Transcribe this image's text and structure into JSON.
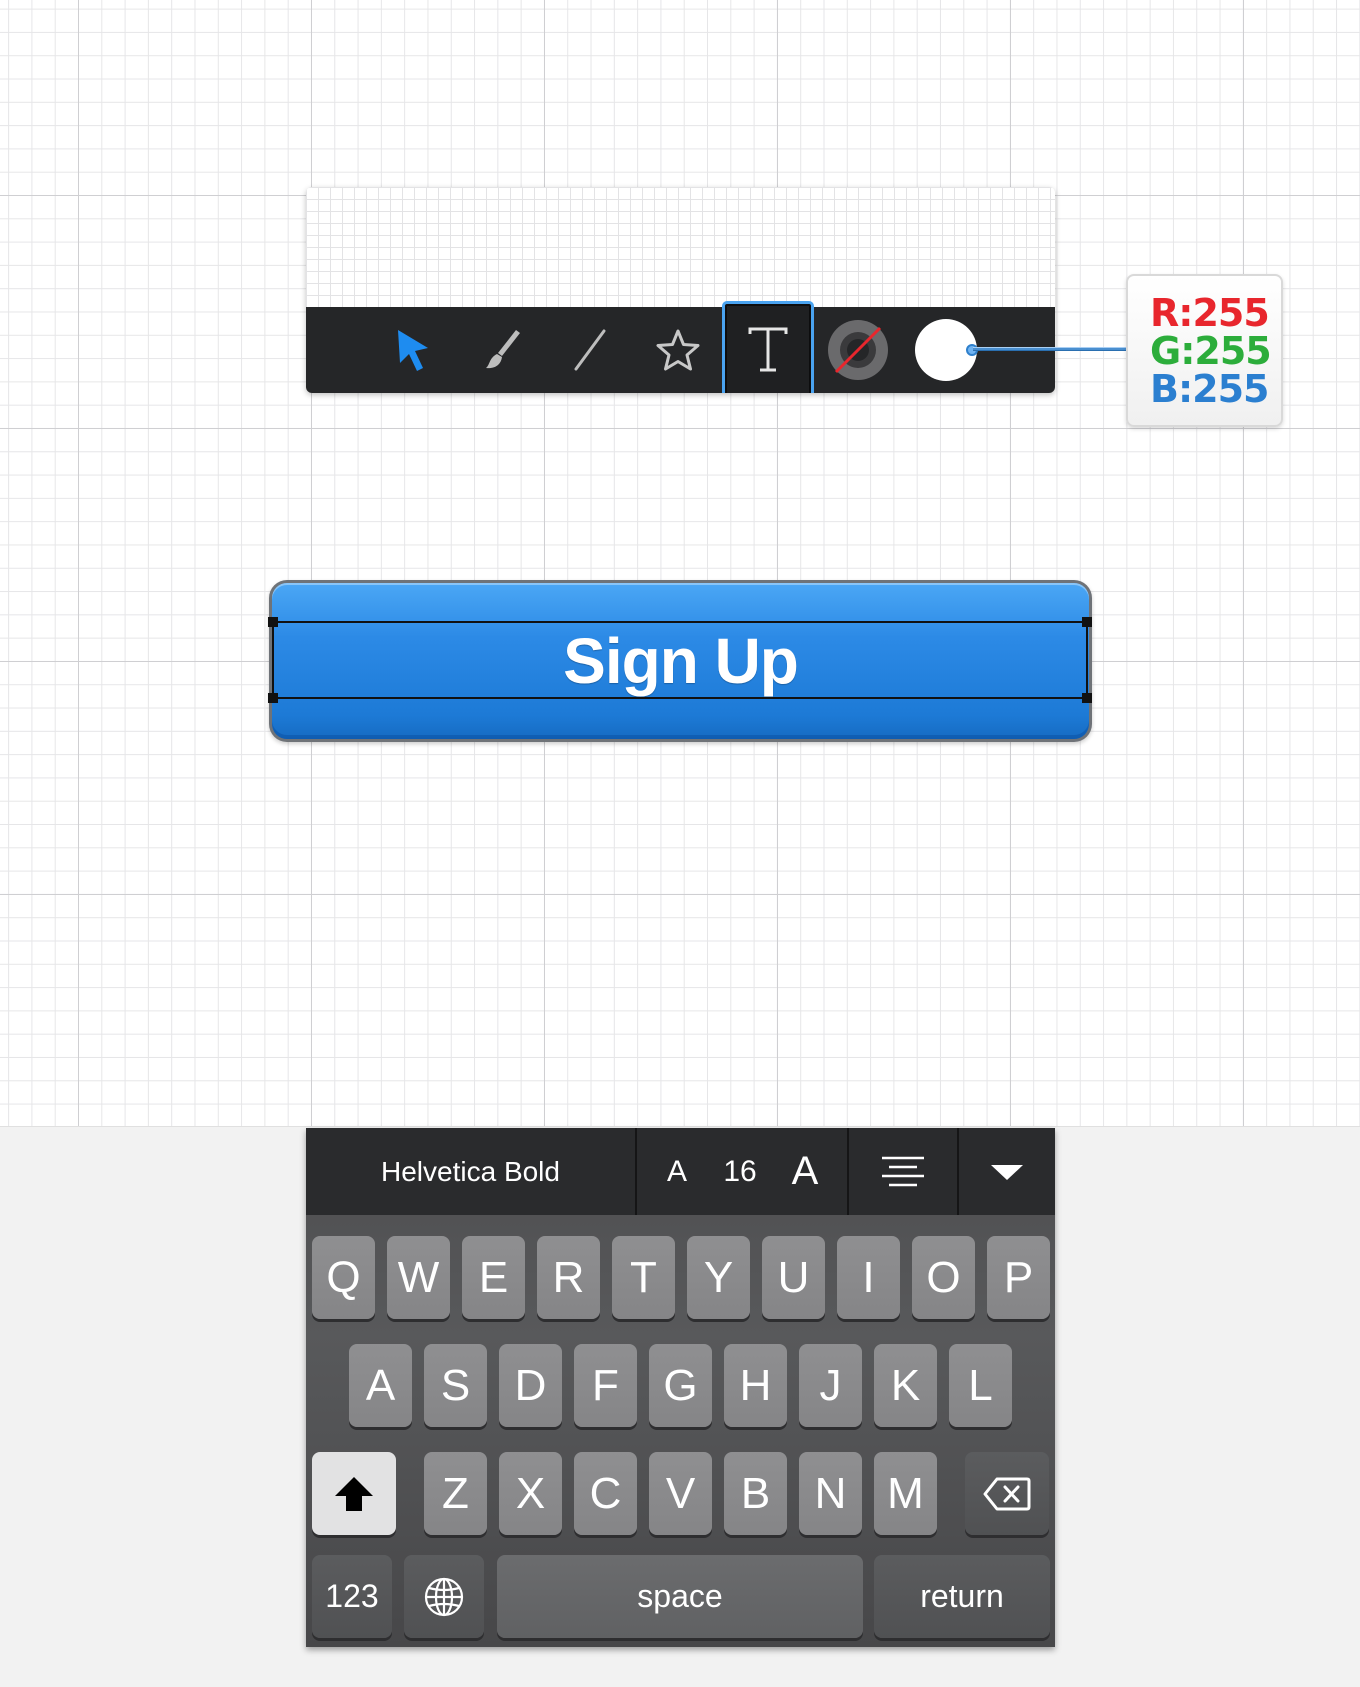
{
  "toolbar": {
    "tools": [
      {
        "name": "select",
        "icon": "cursor-arrow-icon",
        "color": "#1e8cf0"
      },
      {
        "name": "brush",
        "icon": "paintbrush-icon"
      },
      {
        "name": "line",
        "icon": "line-icon"
      },
      {
        "name": "shape",
        "icon": "star-icon"
      },
      {
        "name": "text",
        "icon": "text-tool-icon",
        "selected": true
      },
      {
        "name": "stroke",
        "icon": "no-stroke-icon"
      },
      {
        "name": "fill",
        "icon": "fill-color-swatch-icon",
        "color": "#ffffff"
      }
    ]
  },
  "fill_color": {
    "r_label": "R:255",
    "g_label": "G:255",
    "b_label": "B:255",
    "r_color": "#e8262d",
    "g_color": "#2cad3b",
    "b_color": "#2b7fd0"
  },
  "button": {
    "label": "Sign Up",
    "color": "#2c8ae6"
  },
  "text_toolbar": {
    "font_name": "Helvetica Bold",
    "size_decrease_label": "A",
    "font_size": "16",
    "size_increase_label": "A",
    "align_icon": "align-center-icon",
    "collapse_icon": "chevron-down-icon"
  },
  "keyboard": {
    "row1": [
      "Q",
      "W",
      "E",
      "R",
      "T",
      "Y",
      "U",
      "I",
      "O",
      "P"
    ],
    "row2": [
      "A",
      "S",
      "D",
      "F",
      "G",
      "H",
      "J",
      "K",
      "L"
    ],
    "row3": [
      "Z",
      "X",
      "C",
      "V",
      "B",
      "N",
      "M"
    ],
    "numbers_label": "123",
    "space_label": "space",
    "return_label": "return",
    "shift_icon": "shift-icon",
    "delete_icon": "backspace-icon",
    "globe_icon": "globe-icon"
  }
}
